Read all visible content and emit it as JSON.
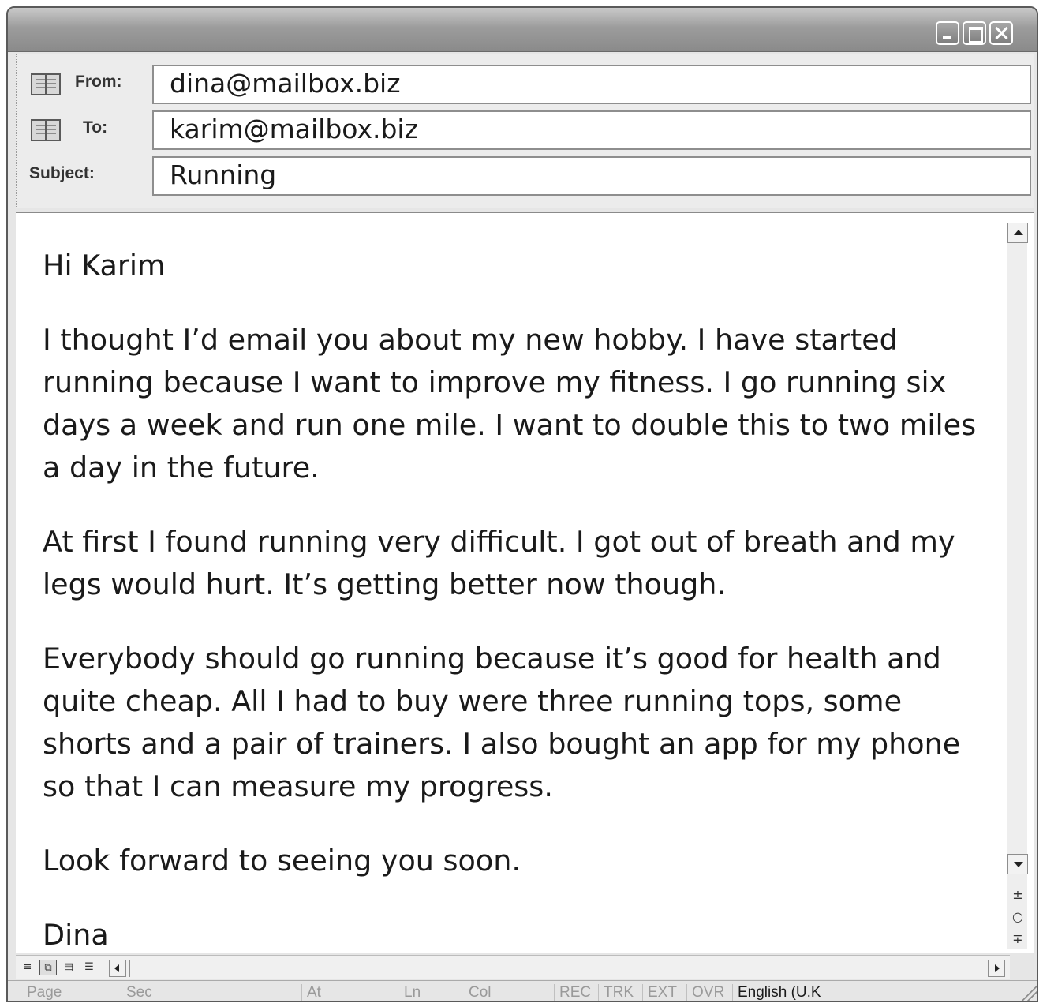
{
  "header": {
    "from_label": "From:",
    "from_value": "dina@mailbox.biz",
    "to_label": "To:",
    "to_value": "karim@mailbox.biz",
    "subject_label": "Subject:",
    "subject_value": "Running"
  },
  "message": {
    "paragraphs": [
      "Hi Karim",
      "I thought I’d email you about my new hobby. I have started running because I want to improve my fitness. I go running six days a week and run one mile. I want to double this to two miles a day in the future.",
      "At first I found running very difficult. I got out of breath and my legs would hurt. It’s getting better now though.",
      "Everybody should go running because it’s good for health and quite cheap. All I had to buy were three running tops, some shorts and a pair of trainers. I also bought an app for my phone so that I can measure my progress.",
      "Look forward to seeing you soon.",
      "Dina"
    ]
  },
  "statusbar": {
    "page": "Page",
    "sec": "Sec",
    "at": "At",
    "ln": "Ln",
    "col": "Col",
    "rec": "REC",
    "trk": "TRK",
    "ext": "EXT",
    "ovr": "OVR",
    "language": "English (U.K"
  },
  "colors": {
    "titlebar": "#9c9c9c",
    "window_border": "#5a5a5a",
    "status_inactive": "#9a9a9a"
  },
  "icons": {
    "address_book": "address-book-icon",
    "minimize": "minimize-icon",
    "maximize": "maximize-icon",
    "close": "close-icon"
  }
}
